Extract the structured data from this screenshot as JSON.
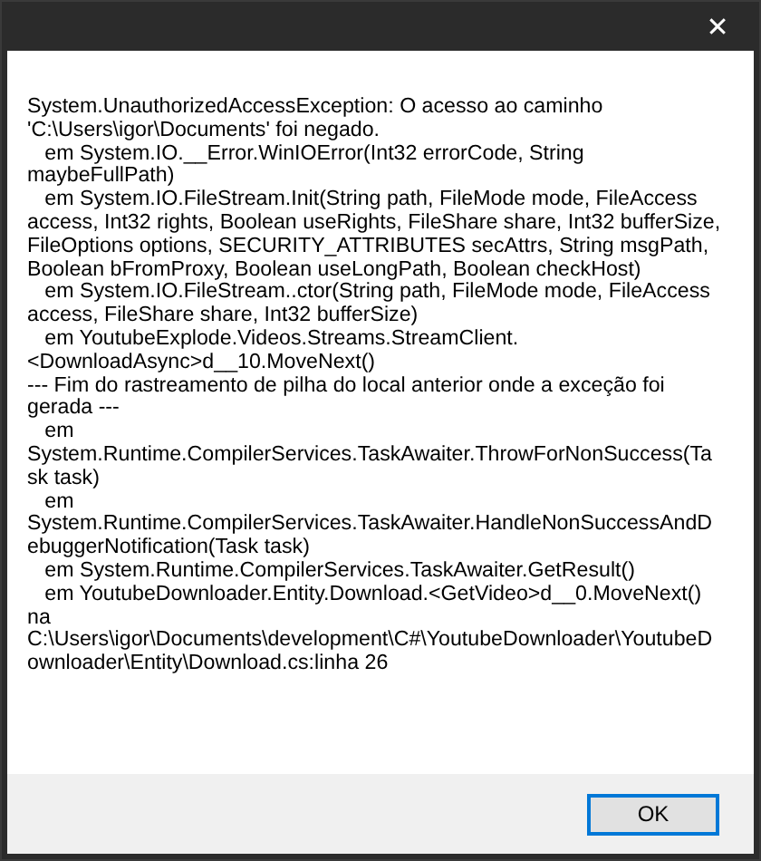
{
  "window": {
    "close_icon": "✕"
  },
  "message": "System.UnauthorizedAccessException: O acesso ao caminho 'C:\\Users\\igor\\Documents' foi negado.\n   em System.IO.__Error.WinIOError(Int32 errorCode, String maybeFullPath)\n   em System.IO.FileStream.Init(String path, FileMode mode, FileAccess access, Int32 rights, Boolean useRights, FileShare share, Int32 bufferSize, FileOptions options, SECURITY_ATTRIBUTES secAttrs, String msgPath, Boolean bFromProxy, Boolean useLongPath, Boolean checkHost)\n   em System.IO.FileStream..ctor(String path, FileMode mode, FileAccess access, FileShare share, Int32 bufferSize)\n   em YoutubeExplode.Videos.Streams.StreamClient.<DownloadAsync>d__10.MoveNext()\n--- Fim do rastreamento de pilha do local anterior onde a exceção foi gerada ---\n   em System.Runtime.CompilerServices.TaskAwaiter.ThrowForNonSuccess(Task task)\n   em System.Runtime.CompilerServices.TaskAwaiter.HandleNonSuccessAndDebuggerNotification(Task task)\n   em System.Runtime.CompilerServices.TaskAwaiter.GetResult()\n   em YoutubeDownloader.Entity.Download.<GetVideo>d__0.MoveNext() na C:\\Users\\igor\\Documents\\development\\C#\\YoutubeDownloader\\YoutubeDownloader\\Entity\\Download.cs:linha 26",
  "buttons": [
    {
      "label": "OK",
      "selected": true
    }
  ]
}
